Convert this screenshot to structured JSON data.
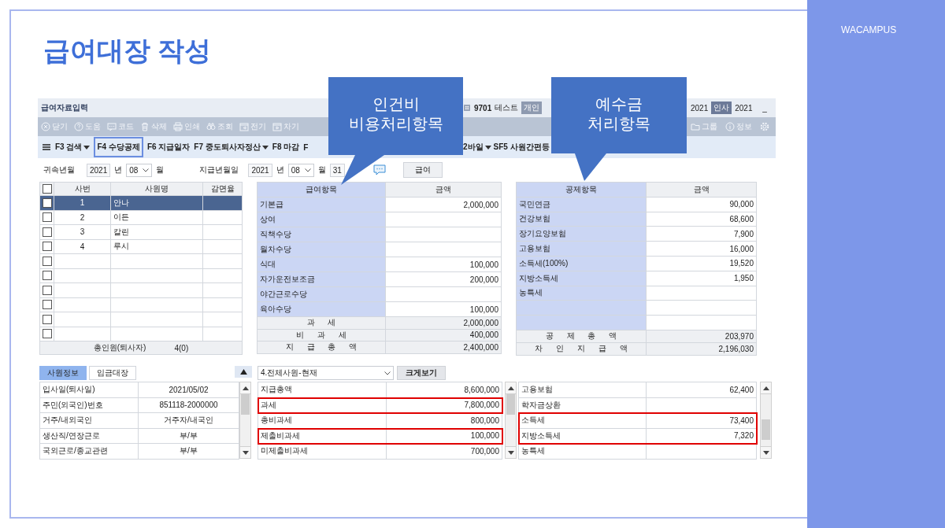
{
  "slide": {
    "title": "급여대장 작성",
    "brand": "WACAMPUS"
  },
  "title_bar": {
    "title": "급여자료입력",
    "company_code": "9701",
    "company_name": "테스트",
    "tag_1": "개인",
    "year_1": "2021",
    "tag_2": "인사",
    "year_2": "2021",
    "minimize": "_"
  },
  "toolbar_left": [
    {
      "kind": "close",
      "label": "닫기"
    },
    {
      "kind": "help",
      "label": "도움"
    },
    {
      "kind": "code",
      "label": "코드"
    },
    {
      "kind": "trash",
      "label": "삭제"
    },
    {
      "kind": "print",
      "label": "인쇄"
    },
    {
      "kind": "search",
      "label": "조회"
    },
    {
      "kind": "prev",
      "label": "전기"
    },
    {
      "kind": "next",
      "label": "차기"
    }
  ],
  "toolbar_right": [
    {
      "kind": "folder",
      "label": "그룹"
    },
    {
      "kind": "info",
      "label": "정보"
    },
    {
      "kind": "gear"
    }
  ],
  "function_bar_left": [
    {
      "label": "F3 검색",
      "dropdown": true,
      "highlighted": false
    },
    {
      "label": "F4 수당공제",
      "dropdown": false,
      "highlighted": true
    },
    {
      "label": "F6 지급일자",
      "dropdown": false,
      "highlighted": false
    },
    {
      "label": "F7 중도퇴사자정산",
      "dropdown": true,
      "highlighted": false
    },
    {
      "label": "F8 마감",
      "dropdown": false,
      "highlighted": false
    },
    {
      "label": "F",
      "dropdown": false,
      "highlighted": false
    }
  ],
  "function_bar_right": [
    {
      "label": "2바일",
      "dropdown": true,
      "highlighted": false
    },
    {
      "label": "SF5 사원간편등",
      "dropdown": false,
      "highlighted": false
    }
  ],
  "period": {
    "attribution_label": "귀속년월",
    "attribution_year": "2021",
    "attribution_year_unit": "년",
    "attribution_month": "08",
    "attribution_month_unit": "월",
    "payment_label": "지급년월일",
    "payment_year": "2021",
    "payment_year_unit": "년",
    "payment_month": "08",
    "payment_month_unit": "월",
    "payment_day": "31",
    "type_button": "급여"
  },
  "employees": {
    "all_checked": false,
    "columns": [
      "사번",
      "사원명",
      "감면율"
    ],
    "rows": [
      {
        "no": "1",
        "name": "안나",
        "checked": false,
        "selected": true
      },
      {
        "no": "2",
        "name": "이든",
        "checked": false,
        "selected": false
      },
      {
        "no": "3",
        "name": "칼린",
        "checked": false,
        "selected": false
      },
      {
        "no": "4",
        "name": "루시",
        "checked": false,
        "selected": false
      },
      {
        "checked": false,
        "selected": false
      },
      {
        "checked": false,
        "selected": false
      },
      {
        "checked": false,
        "selected": false
      },
      {
        "checked": false,
        "selected": false
      },
      {
        "checked": false,
        "selected": false
      },
      {
        "checked": false,
        "selected": false
      }
    ],
    "footer_label": "총인원(퇴사자)",
    "footer_count": "4(0)"
  },
  "earnings": {
    "item_column_highlighted": true,
    "columns": [
      "급여항목",
      "금액"
    ],
    "rows": [
      {
        "item": "기본급",
        "amount": "2,000,000"
      },
      {
        "item": "상여"
      },
      {
        "item": "직책수당"
      },
      {
        "item": "월차수당"
      },
      {
        "item": "식대",
        "amount": "100,000"
      },
      {
        "item": "자가운전보조금",
        "amount": "200,000"
      },
      {
        "item": "야간근로수당"
      },
      {
        "item": "육아수당",
        "amount": "100,000"
      }
    ],
    "summary": [
      {
        "label": "과 세",
        "amount": "2,000,000"
      },
      {
        "label": "비 과 세",
        "amount": "400,000"
      },
      {
        "label": "지 급 총 액",
        "amount": "2,400,000"
      }
    ]
  },
  "deductions": {
    "item_column_highlighted": true,
    "columns": [
      "공제항목",
      "금액"
    ],
    "rows": [
      {
        "item": "국민연금",
        "amount": "90,000"
      },
      {
        "item": "건강보험",
        "amount": "68,600"
      },
      {
        "item": "장기요양보험",
        "amount": "7,900"
      },
      {
        "item": "고용보험",
        "amount": "16,000"
      },
      {
        "item": "소득세(100%)",
        "amount": "19,520"
      },
      {
        "item": "지방소득세",
        "amount": "1,950"
      },
      {
        "item": "농특세"
      },
      {},
      {}
    ],
    "summary": [
      {
        "label": "공 제 총 액",
        "amount": "203,970"
      },
      {
        "label": "차 인 지 급 액",
        "amount": "2,196,030"
      }
    ]
  },
  "employee_info": {
    "tabs": [
      {
        "label": "사원정보",
        "selected": true
      },
      {
        "label": "임금대장",
        "selected": false
      }
    ],
    "rows": [
      {
        "label": "입사일(퇴사일)",
        "value": "2021/05/02"
      },
      {
        "label": "주민(외국인)번호",
        "value": "851118-2000000"
      },
      {
        "label": "거주/내외국인",
        "value": "거주자/내국인"
      },
      {
        "label": "생산직/연장근로",
        "value": "부/부"
      },
      {
        "label": "국외근로/종교관련",
        "value": "부/부"
      }
    ]
  },
  "payroll_summary": {
    "filter": "4.전체사원-현재",
    "enlarge_button": "크게보기",
    "rows": [
      {
        "label": "지급총액",
        "amount": "8,600,000",
        "highlighted": false
      },
      {
        "label": "과세",
        "amount": "7,800,000",
        "highlighted": true
      },
      {
        "label": "총비과세",
        "amount": "800,000",
        "highlighted": false
      },
      {
        "label": "제출비과세",
        "amount": "100,000",
        "highlighted": true
      },
      {
        "label": "미제출비과세",
        "amount": "700,000",
        "highlighted": false
      }
    ]
  },
  "deduction_summary": {
    "rows": [
      {
        "label": "고용보험",
        "amount": "62,400",
        "highlighted": false
      },
      {
        "label": "학자금상환",
        "highlighted": false
      },
      {
        "label": "소득세",
        "amount": "73,400",
        "highlighted": true
      },
      {
        "label": "지방소득세",
        "amount": "7,320",
        "highlighted": true
      },
      {
        "label": "농특세",
        "highlighted": false
      }
    ]
  },
  "callouts": [
    {
      "lines": [
        "인건비",
        "비용처리항목"
      ]
    },
    {
      "lines": [
        "예수금",
        "처리항목"
      ]
    }
  ]
}
